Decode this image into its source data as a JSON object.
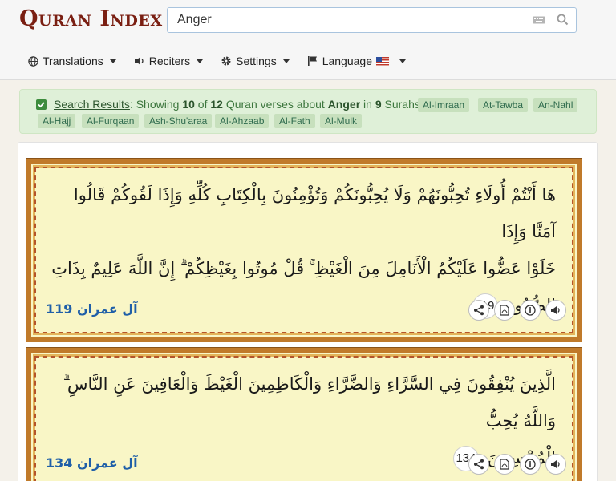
{
  "app": {
    "logo": "Quran Inde",
    "logo_x": "x"
  },
  "search": {
    "value": "Anger"
  },
  "nav": {
    "translations": "Translations",
    "reciters": "Reciters",
    "settings": "Settings",
    "language": "Language"
  },
  "banner": {
    "link": "Search Results",
    "text_a": ": Showing ",
    "shown": "10",
    "text_b": " of ",
    "total": "12",
    "text_c": " Quran verses about ",
    "query": "Anger",
    "text_d": " in ",
    "surah_count": "9",
    "text_e": " Surahs",
    "tags": [
      "Al-Imraan",
      "At-Tawba",
      "An-Nahl",
      "Al-Hajj",
      "Al-Furqaan",
      "Ash-Shu'araa",
      "Al-Ahzaab",
      "Al-Fath",
      "Al-Mulk"
    ]
  },
  "verses": [
    {
      "line1": "هَا أَنْتُمْ أُولَاءِ تُحِبُّونَهُمْ وَلَا يُحِبُّونَكُمْ وَتُؤْمِنُونَ بِالْكِتَابِ كُلِّهِ وَإِذَا لَقُوكُمْ قَالُوا آمَنَّا وَإِذَا",
      "line2": "خَلَوْا عَضُّوا عَلَيْكُمُ الْأَنَامِلَ مِنَ الْغَيْظِ ۚ قُلْ مُوتُوا بِغَيْظِكُمْ ۗ إِنَّ اللَّهَ عَلِيمٌ بِذَاتِ",
      "line3": "الصُّدُورِ",
      "number": "119",
      "reference": "آل عمران 119"
    },
    {
      "line1": "الَّذِينَ يُنْفِقُونَ فِي السَّرَّاءِ وَالضَّرَّاءِ وَالْكَاظِمِينَ الْغَيْظَ وَالْعَافِينَ عَنِ النَّاسِ ۗ وَاللَّهُ يُحِبُّ",
      "line2": "الْمُحْسِنِينَ",
      "number": "134",
      "reference": "آل عمران 134"
    }
  ],
  "icons": [
    "keyboard-icon",
    "search-icon",
    "globe-icon",
    "speaker-icon",
    "gear-icon",
    "flag-icon",
    "us-flag-icon",
    "checkbox-icon",
    "share-icon",
    "pdf-icon",
    "info-icon",
    "audio-icon"
  ]
}
